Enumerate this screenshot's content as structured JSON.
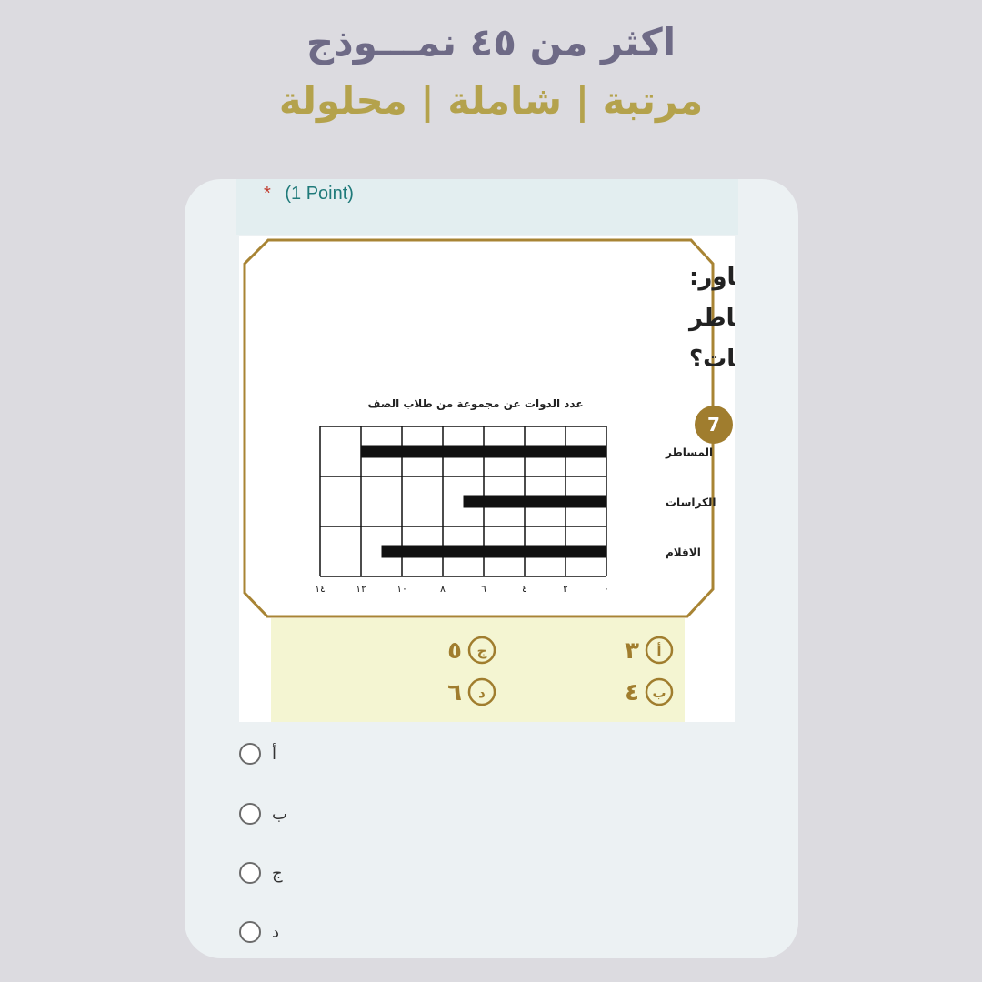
{
  "promo": {
    "line1": "اكثر من ٤٥ نمـــوذج",
    "line2": "مرتبة | شاملة | محلولة"
  },
  "question": {
    "points": "(1 Point)",
    "required_mark": "*",
    "number": "7",
    "text_line1": "في المخطط المجاور:",
    "text_line2": "ما الفرق بين عدد المساطر",
    "text_line3": "والكراسات؟"
  },
  "chart_data": {
    "type": "bar",
    "orientation": "horizontal",
    "title": "عدد الدوات عن مجموعة من طلاب الصف",
    "categories": [
      "المساطر",
      "الكراسات",
      "الاقلام"
    ],
    "values": [
      12,
      7,
      11
    ],
    "xlim": [
      0,
      14
    ],
    "x_tick_values": [
      0,
      2,
      4,
      6,
      8,
      10,
      12,
      14
    ],
    "x_tick_labels": [
      "٠",
      "٢",
      "٤",
      "٦",
      "٨",
      "١٠",
      "١٢",
      "١٤"
    ],
    "x_direction": "right-to-left",
    "grid": true
  },
  "choices_printed": [
    {
      "letter": "أ",
      "value": "٣"
    },
    {
      "letter": "ب",
      "value": "٤"
    },
    {
      "letter": "ج",
      "value": "٥"
    },
    {
      "letter": "د",
      "value": "٦"
    }
  ],
  "answers": [
    {
      "label": "أ"
    },
    {
      "label": "ب"
    },
    {
      "label": "ج"
    },
    {
      "label": "د"
    }
  ],
  "colors": {
    "gold": "#a07d2e",
    "accent_teal": "#1f7a7a",
    "choice_panel": "#f4f5d2"
  }
}
